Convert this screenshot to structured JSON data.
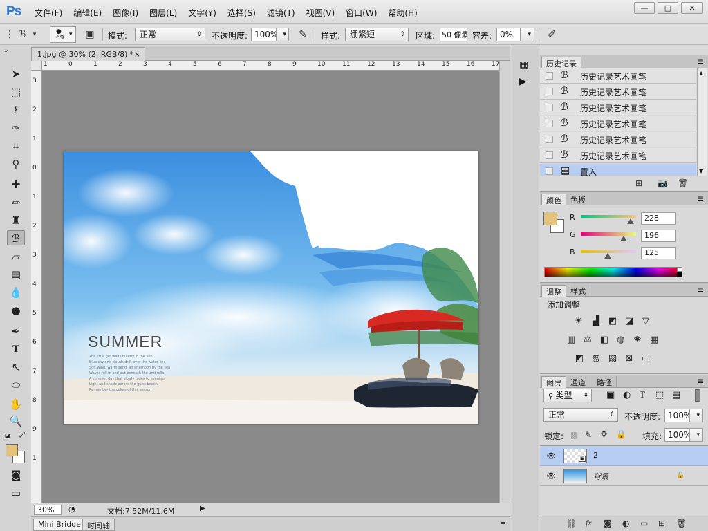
{
  "app": {
    "logo": "Ps"
  },
  "menu": [
    "文件(F)",
    "编辑(E)",
    "图像(I)",
    "图层(L)",
    "文字(Y)",
    "选择(S)",
    "滤镜(T)",
    "视图(V)",
    "窗口(W)",
    "帮助(H)"
  ],
  "window_controls": {
    "minimize": "—",
    "maximize": "□",
    "close": "✕"
  },
  "options": {
    "brush_size": "69",
    "mode_label": "模式:",
    "mode_value": "正常",
    "opacity_label": "不透明度:",
    "opacity_value": "100%",
    "style_label": "样式:",
    "style_value": "绷紧短",
    "area_label": "区域:",
    "area_value": "50 像素",
    "tolerance_label": "容差:",
    "tolerance_value": "0%"
  },
  "document": {
    "tab_title": "1.jpg @ 30% (2, RGB/8) *",
    "ruler_h": [
      "1",
      "0",
      "1",
      "2",
      "3",
      "4",
      "5",
      "6",
      "7",
      "8",
      "9",
      "10",
      "11",
      "12",
      "13",
      "14",
      "15",
      "16",
      "17"
    ],
    "ruler_v": [
      "3",
      "2",
      "1",
      "0",
      "1",
      "2",
      "3",
      "4",
      "5",
      "6",
      "7",
      "8",
      "9",
      "1"
    ],
    "image_title": "SUMMER",
    "image_small_text": [
      "The little girl waits quietly in the sun",
      "Blue sky and clouds drift over the water line",
      "Soft wind, warm sand, an afternoon by the sea",
      "Waves roll in and out beneath the umbrella",
      "A summer day that slowly fades to evening",
      "Light and shade across the quiet beach",
      "Remember the colors of this season"
    ]
  },
  "status": {
    "zoom": "30%",
    "doc_info": "文档:7.52M/11.6M"
  },
  "bottom_tabs": {
    "mini_bridge": "Mini Bridge",
    "timeline": "时间轴"
  },
  "history": {
    "tab": "历史记录",
    "items": [
      {
        "label": "历史记录艺术画笔",
        "selected": false
      },
      {
        "label": "历史记录艺术画笔",
        "selected": false
      },
      {
        "label": "历史记录艺术画笔",
        "selected": false
      },
      {
        "label": "历史记录艺术画笔",
        "selected": false
      },
      {
        "label": "历史记录艺术画笔",
        "selected": false
      },
      {
        "label": "历史记录艺术画笔",
        "selected": false
      },
      {
        "label": "置入",
        "selected": true
      }
    ]
  },
  "color_panel": {
    "tab_color": "颜色",
    "tab_swatches": "色板",
    "r_label": "R",
    "g_label": "G",
    "b_label": "B",
    "r": "228",
    "g": "196",
    "b": "125",
    "r_fraction": 0.894,
    "g_fraction": 0.769,
    "b_fraction": 0.49,
    "foreground": "#e4c47d",
    "background": "#ffffff"
  },
  "adjustments": {
    "tab_adjust": "调整",
    "tab_styles": "样式",
    "add_label": "添加调整"
  },
  "layers": {
    "tab_layers": "图层",
    "tab_channels": "通道",
    "tab_paths": "路径",
    "filter_label": "类型",
    "blend_value": "正常",
    "opacity_label": "不透明度:",
    "opacity_value": "100%",
    "lock_label": "锁定:",
    "fill_label": "填充:",
    "fill_value": "100%",
    "items": [
      {
        "name": "2",
        "selected": true
      },
      {
        "name": "背景",
        "selected": false
      }
    ]
  },
  "colors": {
    "selection": "#b8cdf2",
    "accent": "#2a78d8"
  }
}
